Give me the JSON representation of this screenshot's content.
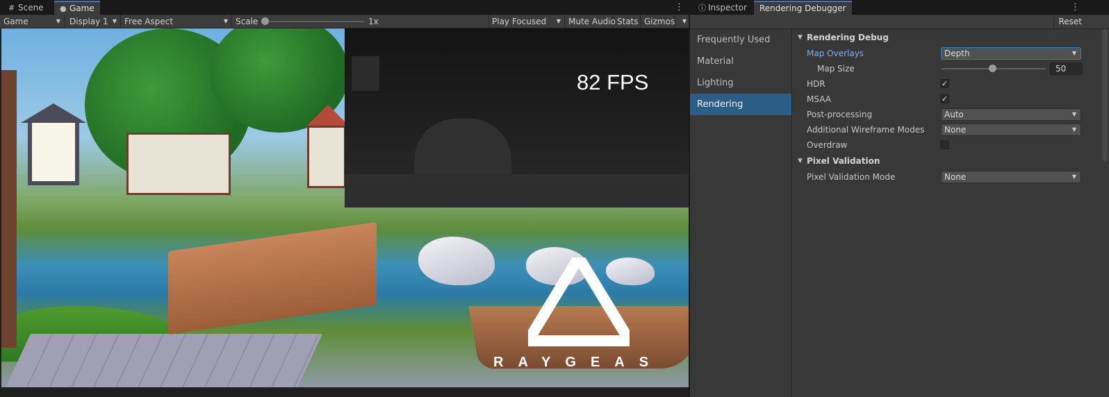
{
  "game_window": {
    "tabs": [
      {
        "label": "Scene",
        "icon": "scene-grid-icon"
      },
      {
        "label": "Game",
        "icon": "gamepad-icon"
      }
    ],
    "toolbar": {
      "view_mode": "Game",
      "display": "Display 1",
      "aspect": "Free Aspect",
      "scale_label": "Scale",
      "scale_value": "1x",
      "play_mode": "Play Focused",
      "mute_audio": "Mute Audio",
      "stats": "Stats",
      "gizmos": "Gizmos"
    },
    "viewport": {
      "fps_text": "82 FPS",
      "logo_text": "RAYGEAS",
      "overlay": "Depth"
    }
  },
  "debugger_window": {
    "tabs": [
      {
        "label": "Inspector",
        "icon": "info-icon"
      },
      {
        "label": "Rendering Debugger"
      }
    ],
    "reset_label": "Reset",
    "nav": [
      "Frequently Used",
      "Material",
      "Lighting",
      "Rendering"
    ],
    "nav_selected": "Rendering",
    "sections": [
      {
        "title": "Rendering Debug",
        "rows": {
          "map_overlays": {
            "label": "Map Overlays",
            "value": "Depth"
          },
          "map_size": {
            "label": "Map Size",
            "value": "50",
            "fraction": 0.5
          },
          "hdr": {
            "label": "HDR",
            "checked": true
          },
          "msaa": {
            "label": "MSAA",
            "checked": true
          },
          "post_processing": {
            "label": "Post-processing",
            "value": "Auto"
          },
          "wireframe": {
            "label": "Additional Wireframe Modes",
            "value": "None"
          },
          "overdraw": {
            "label": "Overdraw",
            "checked": false
          }
        }
      },
      {
        "title": "Pixel Validation",
        "rows": {
          "pixel_validation_mode": {
            "label": "Pixel Validation Mode",
            "value": "None"
          }
        }
      }
    ]
  },
  "colors": {
    "accent_blue": "#3a79bb",
    "selected_nav": "#2c5d87",
    "panel_bg": "#383838",
    "highlight_label": "#7bb0ea"
  }
}
